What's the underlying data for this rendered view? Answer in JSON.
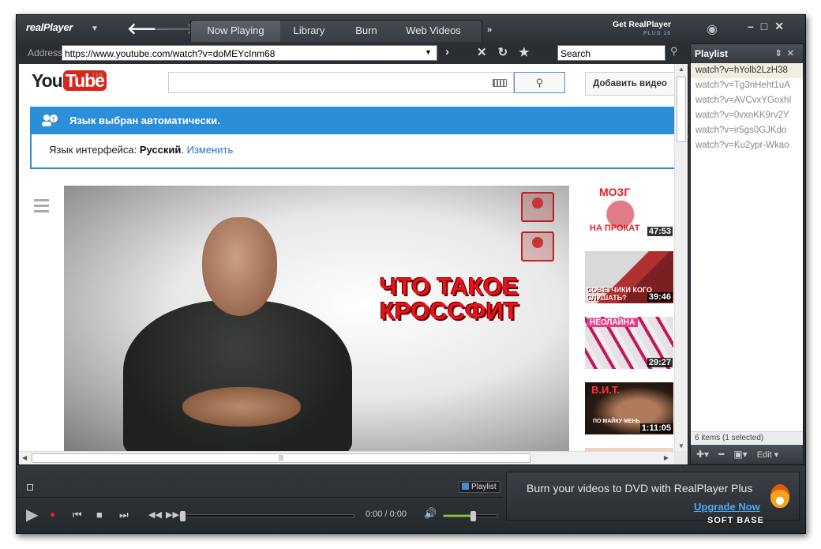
{
  "app": {
    "logo": "realPlayer"
  },
  "tabs": [
    {
      "label": "Now Playing",
      "active": true
    },
    {
      "label": "Library",
      "active": false
    },
    {
      "label": "Burn",
      "active": false
    },
    {
      "label": "Web Videos",
      "active": false
    }
  ],
  "header": {
    "get_rp": "Get RealPlayer",
    "get_rp_sub": "PLUS 16"
  },
  "address": {
    "label": "Address",
    "value": "https://www.youtube.com/watch?v=doMEYcInm68"
  },
  "search": {
    "value": "Search"
  },
  "youtube": {
    "logo_you": "You",
    "logo_tube": "Tube",
    "region": "UA",
    "add_video": "Добавить видео",
    "lang_title": "Язык выбран автоматически.",
    "lang_label": "Язык интерфейса:",
    "lang_value": "Русский",
    "lang_link": "Изменить",
    "video_title_line1": "ЧТО ТАКОЕ",
    "video_title_line2": "КРОССФИТ",
    "thumbs": [
      {
        "text_top": "МОЗГ",
        "text_bottom": "НА ПРОКАТ",
        "duration": "47:53"
      },
      {
        "text_top": "СОВЕТЧИКИ КОГО СЛУШАТЬ?",
        "duration": "39:46"
      },
      {
        "text_top": "НЕОЛАЙНА",
        "duration": "29:27"
      },
      {
        "text_top": "В.И.Т.",
        "text_bottom": "ПО МАЙКУ МЕНЬ",
        "duration": "1:11:05"
      }
    ]
  },
  "playlist": {
    "title": "Playlist",
    "items": [
      {
        "label": "watch?v=hYolb2LzH38",
        "selected": true
      },
      {
        "label": "watch?v=Tg3nHeht1uA",
        "selected": false
      },
      {
        "label": "watch?v=AVCvxYGoxhI",
        "selected": false
      },
      {
        "label": "watch?v=0vxnKK9rv2Y",
        "selected": false
      },
      {
        "label": "watch?v=ir5gs0GJKdo",
        "selected": false
      },
      {
        "label": "watch?v=Ku2ypr-Wkao",
        "selected": false
      }
    ],
    "status": "6 items (1 selected)",
    "edit_label": "Edit"
  },
  "player": {
    "playlist_btn": "Playlist",
    "time": "0:00 / 0:00",
    "volume": 0.55,
    "progress": 0
  },
  "promo": {
    "text": "Burn your videos to DVD with RealPlayer Plus",
    "link": "Upgrade Now"
  },
  "watermark": "SOFT BASE"
}
